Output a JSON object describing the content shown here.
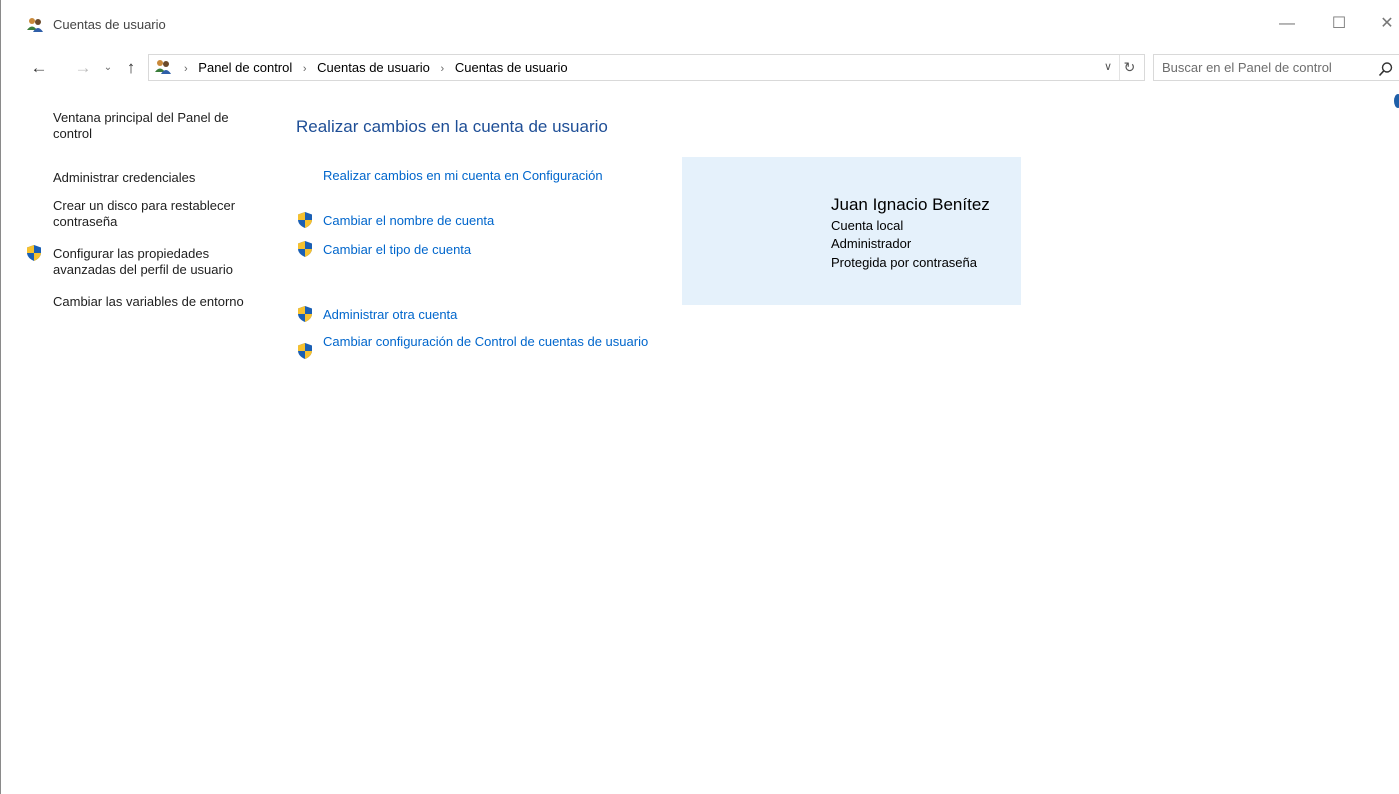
{
  "window": {
    "title": "Cuentas de usuario",
    "minimize_glyph": "—",
    "maximize_glyph": "☐",
    "close_glyph": "✕"
  },
  "nav": {
    "back_glyph": "←",
    "forward_glyph": "→",
    "recent_glyph": "⌄",
    "up_glyph": "↑",
    "breadcrumb": [
      "Panel de control",
      "Cuentas de usuario",
      "Cuentas de usuario"
    ],
    "separator_glyph": "›",
    "dropdown_glyph": "∨",
    "refresh_glyph": "↻"
  },
  "search": {
    "placeholder": "Buscar en el Panel de control"
  },
  "left_pane": {
    "links": [
      {
        "label": "Ventana principal del Panel de control",
        "shield": false
      },
      {
        "label": "Administrar credenciales",
        "shield": false
      },
      {
        "label": "Crear un disco para restablecer contraseña",
        "shield": false
      },
      {
        "label": "Configurar las propiedades avanzadas del perfil de usuario",
        "shield": true
      },
      {
        "label": "Cambiar las variables de entorno",
        "shield": false
      }
    ]
  },
  "main": {
    "title": "Realizar cambios en la cuenta de usuario",
    "settings_link": "Realizar cambios en mi cuenta en Configuración",
    "tasks": [
      {
        "label": "Cambiar el nombre de cuenta",
        "shield": true
      },
      {
        "label": "Cambiar el tipo de cuenta",
        "shield": true
      },
      {
        "label": "Administrar otra cuenta",
        "shield": true
      },
      {
        "label": "Cambiar configuración de Control de cuentas de usuario",
        "shield": true
      }
    ]
  },
  "user": {
    "name": "Juan Ignacio Benítez",
    "account_type": "Cuenta local",
    "role": "Administrador",
    "protection": "Protegida por contraseña"
  },
  "colors": {
    "link": "#0066cc",
    "title": "#1e4e96",
    "user_panel_bg": "#e5f1fb",
    "shield_blue": "#1a5fb4",
    "shield_yellow": "#f6c12f"
  }
}
